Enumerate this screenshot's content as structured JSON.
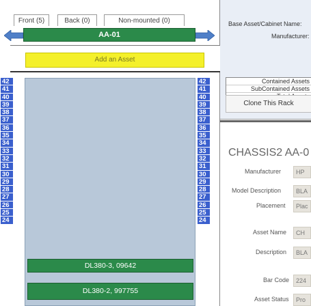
{
  "tabs": {
    "front": "Front (5)",
    "back": "Back (0)",
    "non_mounted": "Non-mounted (0)"
  },
  "rack": {
    "name": "AA-01",
    "add_asset_label": "Add an Asset",
    "slot_numbers": [
      "42",
      "41",
      "40",
      "39",
      "38",
      "37",
      "36",
      "35",
      "34",
      "33",
      "32",
      "31",
      "30",
      "29",
      "28",
      "27",
      "26",
      "25",
      "24"
    ],
    "assets": [
      "DL380-3, 09642",
      "DL380-2, 997755"
    ]
  },
  "info": {
    "base_asset_label": "Base Asset/Cabinet Name:",
    "manufacturer_label": "Manufacturer:",
    "contained_assets": "Contained Assets",
    "subcontained_assets": "SubContained Assets",
    "total_assets": "Total Assets",
    "clone_button": "Clone This Rack"
  },
  "detail": {
    "title": "CHASSIS2 AA-0",
    "fields": [
      {
        "label": "Manufacturer",
        "value": "HP"
      },
      {
        "label": "Model Description",
        "value": "BLA"
      },
      {
        "label": "Placement",
        "value": "Plac"
      },
      {
        "label": "Asset Name",
        "value": "CH"
      },
      {
        "label": "Description",
        "value": "BLA"
      },
      {
        "label": "Bar Code",
        "value": "224"
      },
      {
        "label": "Asset Status",
        "value": "Pro"
      }
    ]
  },
  "colors": {
    "asset_green": "#2b8a4a",
    "slot_blue": "#3a5fcd",
    "add_yellow": "#f4f02a",
    "rack_fill": "#b8c8d9"
  }
}
